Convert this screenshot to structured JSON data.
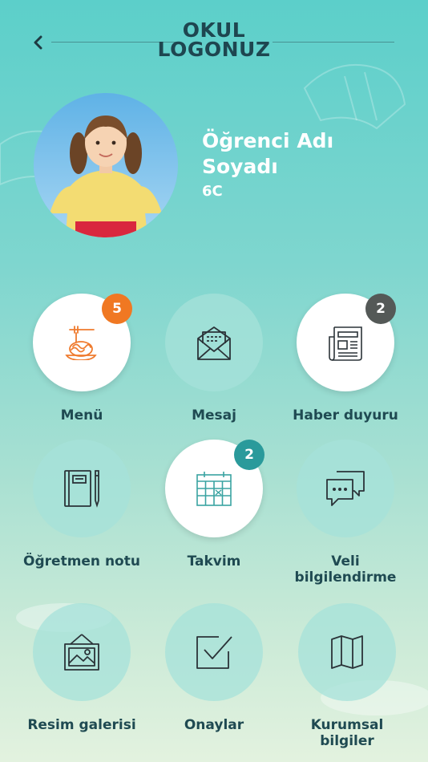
{
  "header": {
    "back_icon": "chevron-left-icon",
    "logo_line1": "OKUL",
    "logo_line2": "LOGONUZ"
  },
  "student": {
    "name": "Öğrenci Adı Soyadı",
    "class": "6C"
  },
  "colors": {
    "orange_badge": "#f07822",
    "gray_badge": "#545957",
    "teal_badge": "#2a9a9b",
    "icon_orange": "#ef7b2e",
    "icon_dark": "#2b3338",
    "icon_teal": "#3aa3a2",
    "label": "#1f4a52"
  },
  "grid": [
    {
      "label": "Menü",
      "icon": "noodles-icon",
      "badge": "5"
    },
    {
      "label": "Mesaj",
      "icon": "envelope-icon",
      "badge": ""
    },
    {
      "label": "Haber duyuru",
      "icon": "newspaper-icon",
      "badge": "2"
    },
    {
      "label": "Öğretmen notu",
      "icon": "notebook-icon",
      "badge": ""
    },
    {
      "label": "Takvim",
      "icon": "calendar-icon",
      "badge": "2"
    },
    {
      "label": "Veli bilgilendirme",
      "icon": "chat-bubbles-icon",
      "badge": ""
    },
    {
      "label": "Resim galerisi",
      "icon": "picture-frame-icon",
      "badge": ""
    },
    {
      "label": "Onaylar",
      "icon": "checkbox-icon",
      "badge": ""
    },
    {
      "label": "Kurumsal bilgiler",
      "icon": "map-icon",
      "badge": ""
    }
  ]
}
